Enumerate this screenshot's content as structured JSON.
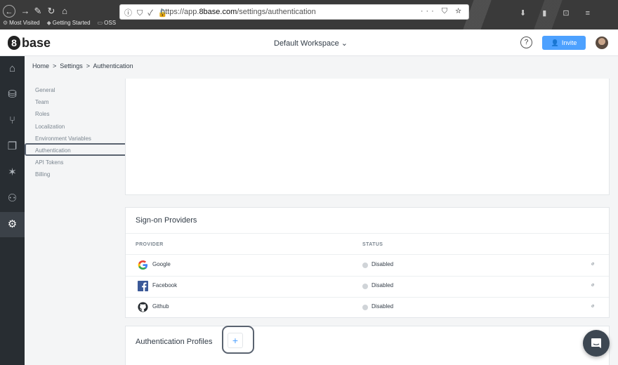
{
  "browser": {
    "url_prefix": "https://app.",
    "url_domain": "8base.com",
    "url_path": "/settings/authentication",
    "bookmarks": [
      "Most Visited",
      "Getting Started",
      "OSS"
    ]
  },
  "header": {
    "logo": "base",
    "logo_mark": "8",
    "workspace": "Default Workspace",
    "help": "?",
    "invite_label": "Invite"
  },
  "breadcrumb": "Home  >  Settings  >  Authentication",
  "settings_menu": [
    "General",
    "Team",
    "Roles",
    "Localization",
    "Environment Variables",
    "Authentication",
    "API Tokens",
    "Billing"
  ],
  "providers": {
    "title": "Sign-on Providers",
    "col_provider": "PROVIDER",
    "col_status": "STATUS",
    "rows": [
      {
        "name": "Google",
        "status": "Disabled",
        "icon": "google-icon"
      },
      {
        "name": "Facebook",
        "status": "Disabled",
        "icon": "facebook-icon"
      },
      {
        "name": "Github",
        "status": "Disabled",
        "icon": "github-icon"
      }
    ]
  },
  "profiles": {
    "title": "Authentication Profiles",
    "add_label": "+"
  },
  "colors": {
    "accent": "#4da1ff",
    "sidebar": "#282d32"
  }
}
